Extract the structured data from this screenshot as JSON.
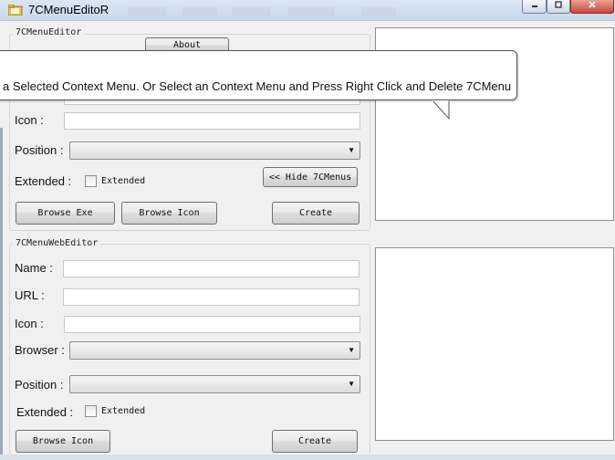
{
  "window": {
    "title": "7CMenuEditoR"
  },
  "caption": {
    "minimize_icon": "minimize-icon",
    "maximize_icon": "maximize-icon",
    "close_icon": "close-icon"
  },
  "exe_group": {
    "title": "7CMenuEditor",
    "about_label": "About",
    "icon_label": "Icon :",
    "position_label": "Position :",
    "extended_label": "Extended :",
    "extended_check_label": "Extended",
    "hide_label": "<< Hide 7CMenus",
    "browse_exe_label": "Browse Exe",
    "browse_icon_label": "Browse Icon",
    "create_label": "Create"
  },
  "web_group": {
    "title": "7CMenuWebEditor",
    "name_label": "Name :",
    "url_label": "URL :",
    "icon_label": "Icon :",
    "browser_label": "Browser :",
    "position_label": "Position :",
    "extended_label": "Extended :",
    "extended_check_label": "Extended",
    "browse_icon_label": "Browse Icon",
    "create_label": "Create"
  },
  "tooltip": {
    "text": "a Selected Context Menu. Or Select an Context Menu and Press Right Click and Delete 7CMenu"
  },
  "colors": {
    "title_bar": "#c9d8ea",
    "panel": "#ffffff",
    "background": "#f0f0f0",
    "close_button": "#c9483a"
  }
}
